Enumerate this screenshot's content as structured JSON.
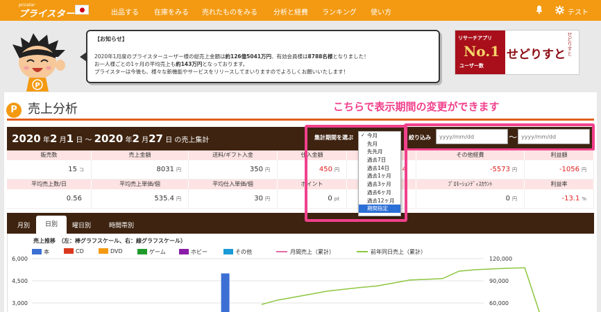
{
  "nav": {
    "logo_small": "pricetar",
    "logo_main": "プライスター",
    "items": [
      "出品する",
      "在庫をみる",
      "売れたものをみる",
      "分析と経費",
      "ランキング",
      "使い方"
    ],
    "user": "テスト"
  },
  "notice": {
    "title": "【お知らせ】",
    "line1_a": "2020年1月度のプライスターユーザー様の総売上金額は",
    "line1_b": "約126億5041万円",
    "line1_c": "、有効会員様は",
    "line1_d": "8788名様",
    "line1_e": "となりました！",
    "line2_a": "お一人様ごとの1ヶ月の平均売上も",
    "line2_b": "約143万円",
    "line2_c": "となっております。",
    "line3": "プライスターは今後も、様々な新機能やサービスをリリースしてまいりますのでよろしくお願いいたします！"
  },
  "banner": {
    "sub": "リサーチアプリ",
    "no1": "No.1",
    "ribbon": "ユーザー数",
    "main": "せどりすと",
    "edge": "せどりすと"
  },
  "section": {
    "title": "売上分析",
    "annotation": "こちらで表示期間の変更ができます"
  },
  "date_range": {
    "y1": "2020",
    "m1": "2",
    "d1": "1",
    "y2": "2020",
    "m2": "2",
    "d2": "27",
    "u_year": "年",
    "u_month": "月",
    "u_day": "日",
    "sep": "〜",
    "suffix": "の売上集計"
  },
  "filters": {
    "period_label": "集計期間を選ぶ",
    "narrow_label": "絞り込み",
    "from_placeholder": "yyyy/mm/dd",
    "to_placeholder": "yyyy/mm/dd",
    "tilde": "〜"
  },
  "period_options": [
    "今月",
    "先月",
    "先先月",
    "過去7日",
    "過去14日",
    "過去1ヶ月",
    "過去3ヶ月",
    "過去6ヶ月",
    "過去12ヶ月",
    "期間指定"
  ],
  "stats": {
    "row1_headers": [
      "販売数",
      "売上金額",
      "送料/ギフト入金",
      "仕入金額",
      "",
      "その他経費",
      "利益額"
    ],
    "row1_values": [
      {
        "v": "15",
        "u": "コ"
      },
      {
        "v": "8031",
        "u": "円"
      },
      {
        "v": "350",
        "u": "円"
      },
      {
        "v": "450",
        "u": "円"
      },
      {
        "v": "4",
        "u": ""
      },
      {
        "v": "-5573",
        "u": "円"
      },
      {
        "v": "-1056",
        "u": "円"
      }
    ],
    "row2_headers": [
      "平均売上数/日",
      "平均売上単価/個",
      "平均仕入単価/個",
      "ポイント",
      "",
      "ﾌﾟﾛﾓｰｼｮﾝﾃﾞｨｽｶｳﾝﾄ",
      "利益率"
    ],
    "row2_values": [
      {
        "v": "0.56",
        "u": ""
      },
      {
        "v": "535.4",
        "u": "円"
      },
      {
        "v": "30",
        "u": "円"
      },
      {
        "v": "0",
        "u": "pt"
      },
      {
        "v": "",
        "u": ""
      },
      {
        "v": "0",
        "u": "円"
      },
      {
        "v": "-13.1",
        "u": "%"
      }
    ]
  },
  "tabs": [
    "月別",
    "日別",
    "曜日別",
    "時間帯別"
  ],
  "chart_data": {
    "type": "bar",
    "title": "売上推移　（左：棒グラフスケール、右：線グラフスケール）",
    "legend": [
      {
        "name": "本",
        "color": "#3b6fd4",
        "kind": "bar"
      },
      {
        "name": "CD",
        "color": "#d9381e",
        "kind": "bar"
      },
      {
        "name": "DVD",
        "color": "#f39a12",
        "kind": "bar"
      },
      {
        "name": "ゲーム",
        "color": "#1f9a2a",
        "kind": "bar"
      },
      {
        "name": "ホビー",
        "color": "#8a1ba8",
        "kind": "bar"
      },
      {
        "name": "その他",
        "color": "#1a9ad6",
        "kind": "bar"
      },
      {
        "name": "月間売上（累計）",
        "color": "#e26aa6",
        "kind": "line"
      },
      {
        "name": "前年同日売上（累計）",
        "color": "#8cc63f",
        "kind": "line"
      }
    ],
    "left_ticks": [
      "6,000",
      "4,500",
      "3,000"
    ],
    "right_ticks": [
      "120,000",
      "90,000",
      "60,000"
    ],
    "ylim_left": [
      0,
      6000
    ],
    "ylim_right": [
      0,
      120000
    ],
    "bars": [
      {
        "day": 9,
        "series": "本",
        "value": 5000
      }
    ],
    "prev_year_cumulative": [
      {
        "day": 11,
        "value": 58000
      },
      {
        "day": 12,
        "value": 64000
      },
      {
        "day": 14,
        "value": 72000
      },
      {
        "day": 15,
        "value": 76000
      },
      {
        "day": 17,
        "value": 81000
      },
      {
        "day": 18,
        "value": 83000
      },
      {
        "day": 19,
        "value": 87000
      },
      {
        "day": 20,
        "value": 91000
      },
      {
        "day": 21,
        "value": 92000
      },
      {
        "day": 22,
        "value": 93000
      },
      {
        "day": 23,
        "value": 103000
      },
      {
        "day": 24,
        "value": 105000
      },
      {
        "day": 25,
        "value": 106000
      },
      {
        "day": 26,
        "value": 107000
      },
      {
        "day": 27,
        "value": 107500
      },
      {
        "day": 28,
        "value": 40000
      }
    ]
  }
}
